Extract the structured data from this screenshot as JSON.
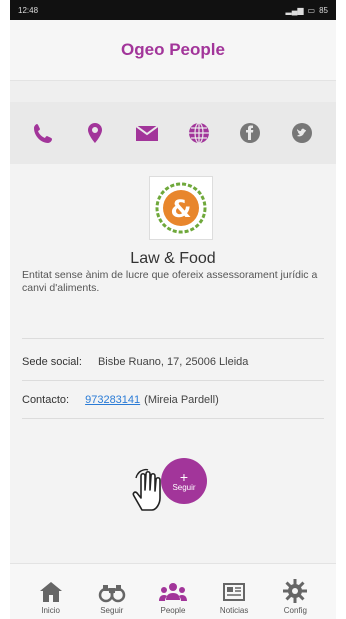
{
  "status_bar": {
    "time": "12:48",
    "battery": "85"
  },
  "app": {
    "title": "Ogeo People"
  },
  "contact_icons": [
    {
      "name": "phone-icon"
    },
    {
      "name": "location-pin-icon"
    },
    {
      "name": "mail-icon"
    },
    {
      "name": "globe-icon"
    },
    {
      "name": "facebook-icon"
    },
    {
      "name": "twitter-icon"
    }
  ],
  "organization": {
    "name": "Law & Food",
    "logo_glyph": "&",
    "description": "Entitat sense ànim de lucre que ofereix assessorament jurídic a canvi d'aliments."
  },
  "details": {
    "sede_label": "Sede social:",
    "sede_value": "Bisbe Ruano, 17, 25006 Lleida",
    "contact_label": "Contacto:",
    "contact_phone": "973283141",
    "contact_person": "(Mireia Pardell)"
  },
  "follow_button": {
    "plus": "+",
    "label": "Seguir"
  },
  "bottom_nav": [
    {
      "label": "Inicio",
      "icon": "home-icon"
    },
    {
      "label": "Seguir",
      "icon": "binoculars-icon"
    },
    {
      "label": "People",
      "icon": "people-icon",
      "active": true
    },
    {
      "label": "Noticias",
      "icon": "news-icon"
    },
    {
      "label": "Config",
      "icon": "gear-icon"
    }
  ],
  "colors": {
    "accent": "#a2359a",
    "link": "#2a7bd6",
    "logo_orange": "#e8862c",
    "logo_green": "#6fa83b"
  }
}
